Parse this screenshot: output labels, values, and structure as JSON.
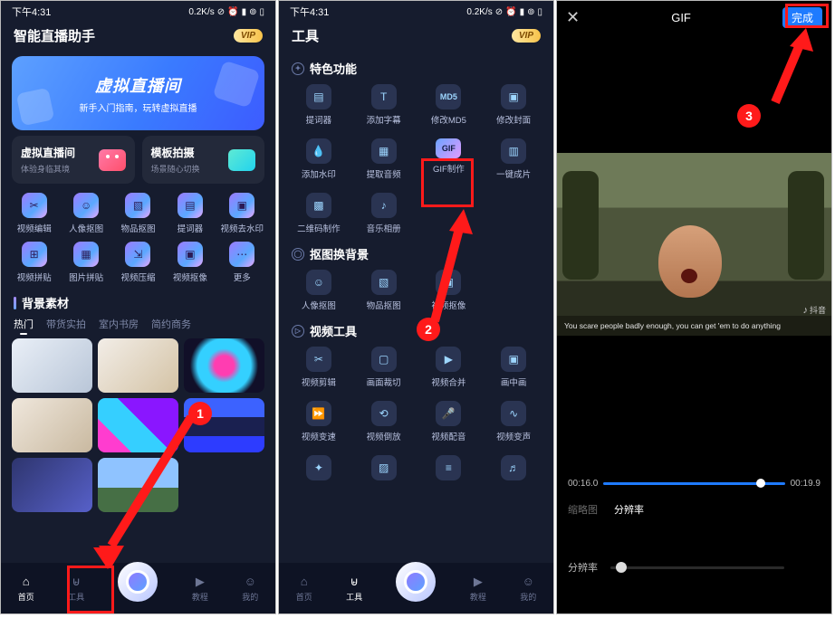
{
  "status_time": "下午4:31",
  "status_net": "0.2K/s",
  "panel1": {
    "title": "智能直播助手",
    "vip": "VIP",
    "hero_title": "虚拟直播间",
    "hero_sub": "新手入门指南，玩转虚拟直播",
    "card1_title": "虚拟直播间",
    "card1_sub": "体验身临其境",
    "card2_title": "模板拍摄",
    "card2_sub": "场景随心切换",
    "tools": [
      "视频编辑",
      "人像抠图",
      "物品抠图",
      "提词器",
      "视频去水印",
      "视频拼贴",
      "图片拼贴",
      "视频压缩",
      "视频抠像",
      "更多"
    ],
    "section_bg": "背景素材",
    "tabs": [
      "热门",
      "带货实拍",
      "室内书房",
      "简约商务"
    ]
  },
  "panel2": {
    "title": "工具",
    "vip": "VIP",
    "sec1": "特色功能",
    "sec1_items": [
      "提词器",
      "添加字幕",
      "修改MD5",
      "修改封面",
      "添加水印",
      "提取音频",
      "GIF制作",
      "一键成片",
      "二维码制作",
      "音乐相册"
    ],
    "sec2": "抠图换背景",
    "sec2_items": [
      "人像抠图",
      "物品抠图",
      "视频抠像"
    ],
    "sec3": "视频工具",
    "sec3_items": [
      "视频剪辑",
      "画面裁切",
      "视频合并",
      "画中画",
      "视频变速",
      "视频倒放",
      "视频配音",
      "视频变声"
    ]
  },
  "nav": [
    "首页",
    "工具",
    "",
    "教程",
    "我的"
  ],
  "panel3": {
    "title": "GIF",
    "done": "完成",
    "subtitle": "You scare people badly enough, you can get 'em to do anything",
    "time_start": "00:16.0",
    "time_end": "00:19.9",
    "tab_thumb": "缩略图",
    "tab_res": "分辨率",
    "res_label": "分辨率",
    "dy": "抖音"
  },
  "steps": {
    "s1": "1",
    "s2": "2",
    "s3": "3"
  }
}
